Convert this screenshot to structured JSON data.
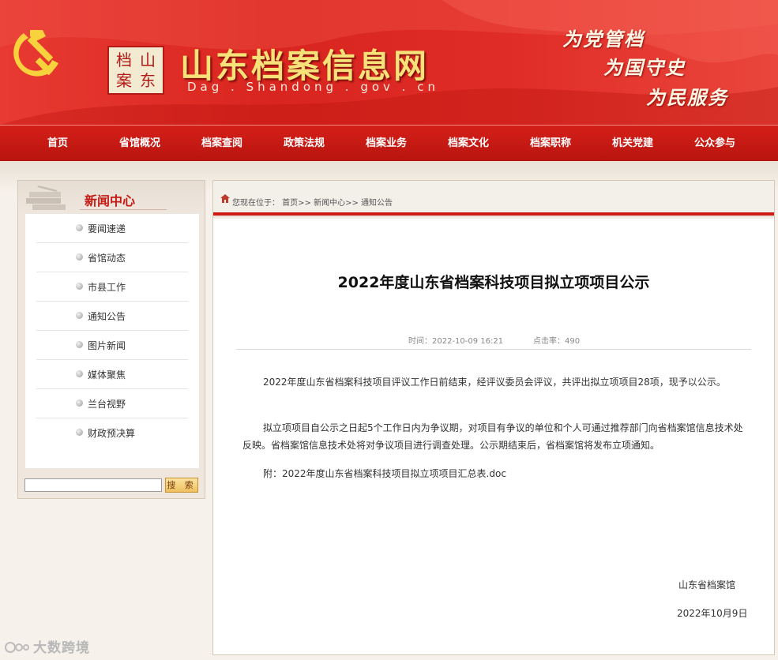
{
  "header": {
    "seal_chars": [
      "档",
      "山",
      "案",
      "东"
    ],
    "title": "山东档案信息网",
    "subtitle": "Dag . Shandong . gov . cn",
    "slogans": [
      "为党管档",
      "为国守史",
      "为民服务"
    ],
    "colors": {
      "primary_red": "#d51f18",
      "title_gold": "#f7e27a"
    }
  },
  "nav": {
    "items": [
      "首页",
      "省馆概况",
      "档案查阅",
      "政策法规",
      "档案业务",
      "档案文化",
      "档案职称",
      "机关党建",
      "公众参与"
    ]
  },
  "sidebar": {
    "title": "新闻中心",
    "items": [
      "要闻速递",
      "省馆动态",
      "市县工作",
      "通知公告",
      "图片新闻",
      "媒体聚焦",
      "兰台视野",
      "财政预决算"
    ],
    "search": {
      "value": "",
      "button_label": "搜 索"
    }
  },
  "main": {
    "breadcrumb": "您现在位于： 首页>> 新闻中心>> 通知公告",
    "title": "2022年度山东省档案科技项目拟立项项目公示",
    "time": "时间：2022-10-09 16:21",
    "hits": "点击率：490",
    "paragraphs": [
      "2022年度山东省档案科技项目评议工作日前结束，经评议委员会评议，共评出拟立项项目28项，现予以公示。",
      "拟立项项目自公示之日起5个工作日内为争议期，对项目有争议的单位和个人可通过推荐部门向省档案馆信息技术处反映。省档案馆信息技术处将对争议项目进行调查处理。公示期结束后，省档案馆将发布立项通知。",
      "附：2022年度山东省档案科技项目拟立项项目汇总表.doc"
    ],
    "signature_org": "山东省档案馆",
    "signature_date": "2022年10月9日"
  },
  "watermark": "大数跨境"
}
